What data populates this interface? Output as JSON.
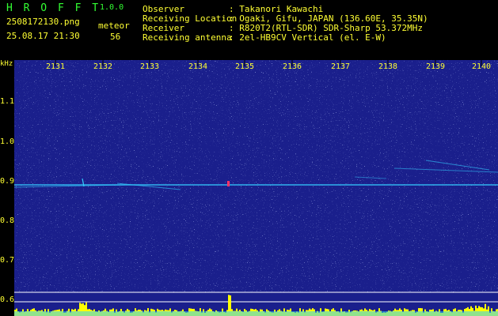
{
  "header": {
    "app_name": "H R O F F T",
    "version": "1.0.0",
    "filename": "2508172130.png",
    "datetime": "25.08.17 21:30",
    "count_label": "meteor",
    "count_value": "56",
    "info_labels": [
      "Observer",
      "Receiving Location",
      "Receiver",
      "Receiving antenna"
    ],
    "info_values": [
      ": Takanori Kawachi",
      ": Ogaki, Gifu, JAPAN (136.60E, 35.35N)",
      ": R820T2(RTL-SDR) SDR-Sharp 53.372MHz",
      ": 2el-HB9CV Vertical (el. E-W)"
    ]
  },
  "chart_data": {
    "type": "heatmap",
    "ylabel": "kHz",
    "y_ticks": [
      "1.1",
      "1.0",
      "0.9",
      "0.8",
      "0.7",
      "0.6"
    ],
    "x_ticks": [
      "2131",
      "2132",
      "2133",
      "2134",
      "2135",
      "2136",
      "2137",
      "2138",
      "2139",
      "2140"
    ],
    "ylim": [
      0.58,
      1.2
    ],
    "carrier_khz": 0.89,
    "background_color": "#1a1f8c",
    "signal_color": "#33ccff",
    "amplitude_color": "#ffff00"
  }
}
